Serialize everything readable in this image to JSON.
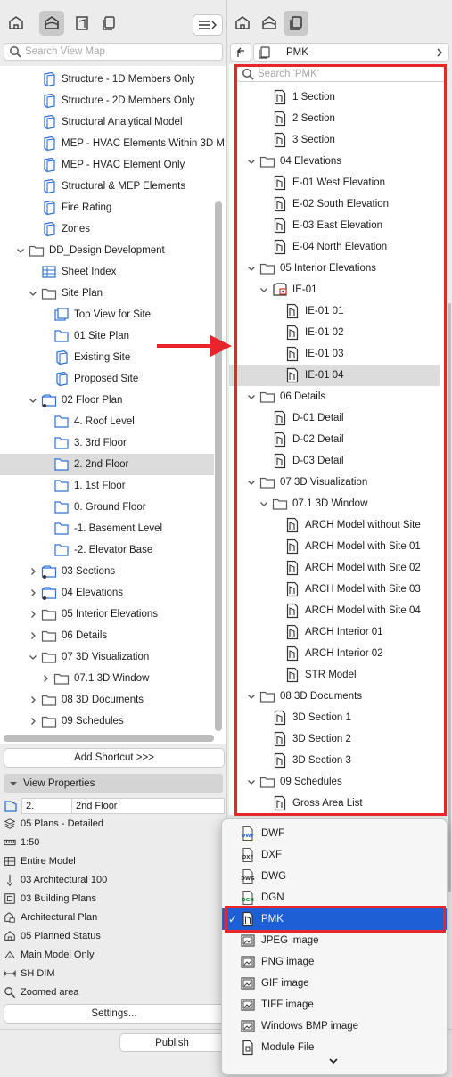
{
  "colors": {
    "accent": "#1f5fd6",
    "annotation": "#e8252b",
    "folder_icon": "#5b5b5b",
    "view_icon": "#2f6fd0"
  },
  "left_toolbar": {
    "buttons": [
      "project-map-icon",
      "view-map-icon",
      "layout-book-icon",
      "publisher-sets-icon"
    ],
    "menu_button": "menu-icon",
    "expand_button": "chevron-right-icon"
  },
  "right_toolbar": {
    "buttons": [
      "project-map-icon",
      "view-map-icon",
      "publisher-sets-icon"
    ]
  },
  "left_search": {
    "placeholder": "Search View Map"
  },
  "right_header": {
    "title": "PMK",
    "back_icon": "back-arrow-icon",
    "chevron": "chevron-right-icon"
  },
  "right_search": {
    "placeholder": "Search 'PMK'"
  },
  "left_tree": [
    {
      "label": "Structure - 1D Members Only",
      "icon": "view-3d-icon",
      "indent": 1
    },
    {
      "label": "Structure - 2D Members Only",
      "icon": "view-3d-icon",
      "indent": 1
    },
    {
      "label": "Structural Analytical Model",
      "icon": "view-3d-icon",
      "indent": 1
    },
    {
      "label": "MEP - HVAC Elements Within 3D M",
      "icon": "view-3d-icon",
      "indent": 1
    },
    {
      "label": "MEP - HVAC Element Only",
      "icon": "view-3d-icon",
      "indent": 1
    },
    {
      "label": "Structural & MEP Elements",
      "icon": "view-3d-icon",
      "indent": 1
    },
    {
      "label": "Fire Rating",
      "icon": "view-3d-icon",
      "indent": 1
    },
    {
      "label": "Zones",
      "icon": "view-3d-icon",
      "indent": 1
    },
    {
      "label": "DD_Design Development",
      "icon": "folder-icon",
      "indent": 0,
      "expand": "down"
    },
    {
      "label": "Sheet Index",
      "icon": "schedule-icon",
      "indent": 1
    },
    {
      "label": "Site Plan",
      "icon": "folder-icon",
      "indent": 1,
      "expand": "down"
    },
    {
      "label": "Top View for Site",
      "icon": "top-view-icon",
      "indent": 2
    },
    {
      "label": "01 Site Plan",
      "icon": "floor-plan-icon",
      "indent": 2
    },
    {
      "label": "Existing Site",
      "icon": "view-3d-icon",
      "indent": 2
    },
    {
      "label": "Proposed Site",
      "icon": "view-3d-icon",
      "indent": 2
    },
    {
      "label": "02 Floor Plan",
      "icon": "floor-plan-folder-icon",
      "indent": 1,
      "expand": "down"
    },
    {
      "label": "4. Roof Level",
      "icon": "floor-plan-icon",
      "indent": 2
    },
    {
      "label": "3. 3rd Floor",
      "icon": "floor-plan-icon",
      "indent": 2
    },
    {
      "label": "2. 2nd Floor",
      "icon": "floor-plan-icon",
      "indent": 2,
      "selected": true
    },
    {
      "label": "1. 1st Floor",
      "icon": "floor-plan-icon",
      "indent": 2
    },
    {
      "label": "0. Ground Floor",
      "icon": "floor-plan-icon",
      "indent": 2
    },
    {
      "label": "-1. Basement Level",
      "icon": "floor-plan-icon",
      "indent": 2
    },
    {
      "label": "-2. Elevator Base",
      "icon": "floor-plan-icon",
      "indent": 2
    },
    {
      "label": "03 Sections",
      "icon": "section-folder-icon",
      "indent": 1,
      "expand": "right"
    },
    {
      "label": "04 Elevations",
      "icon": "elevation-folder-icon",
      "indent": 1,
      "expand": "right"
    },
    {
      "label": "05 Interior Elevations",
      "icon": "folder-icon",
      "indent": 1,
      "expand": "right"
    },
    {
      "label": "06 Details",
      "icon": "folder-icon",
      "indent": 1,
      "expand": "right"
    },
    {
      "label": "07 3D Visualization",
      "icon": "folder-icon",
      "indent": 1,
      "expand": "down"
    },
    {
      "label": "07.1 3D Window",
      "icon": "folder-icon",
      "indent": 2,
      "expand": "right"
    },
    {
      "label": "08 3D Documents",
      "icon": "folder-icon",
      "indent": 1,
      "expand": "right"
    },
    {
      "label": "09 Schedules",
      "icon": "folder-icon",
      "indent": 1,
      "expand": "right"
    }
  ],
  "add_shortcut": {
    "label": "Add Shortcut >>>"
  },
  "view_properties": {
    "title": "View Properties",
    "id_value": "2.",
    "name_value": "2nd Floor",
    "rows": [
      {
        "icon": "layer-combination-icon",
        "text": "05 Plans - Detailed"
      },
      {
        "icon": "scale-icon",
        "text": "1:50"
      },
      {
        "icon": "structure-display-icon",
        "text": "Entire Model"
      },
      {
        "icon": "pen-set-icon",
        "text": "03 Architectural 100"
      },
      {
        "icon": "model-view-options-icon",
        "text": "03 Building Plans"
      },
      {
        "icon": "graphic-override-icon",
        "text": "Architectural Plan"
      },
      {
        "icon": "renovation-filter-icon",
        "text": "05 Planned Status"
      },
      {
        "icon": "partial-structure-icon",
        "text": "Main Model Only"
      },
      {
        "icon": "dimension-icon",
        "text": "SH DIM"
      },
      {
        "icon": "zoom-icon",
        "text": "Zoomed area"
      }
    ],
    "settings_label": "Settings..."
  },
  "publish_label": "Publish",
  "right_tree": [
    {
      "label": "1 Section",
      "icon": "drawing-file-icon",
      "indent": 2
    },
    {
      "label": "2 Section",
      "icon": "drawing-file-icon",
      "indent": 2
    },
    {
      "label": "3 Section",
      "icon": "drawing-file-icon",
      "indent": 2
    },
    {
      "label": "04 Elevations",
      "icon": "folder-icon",
      "indent": 1,
      "expand": "down"
    },
    {
      "label": "E-01 West Elevation",
      "icon": "drawing-file-icon",
      "indent": 2
    },
    {
      "label": "E-02 South Elevation",
      "icon": "drawing-file-icon",
      "indent": 2
    },
    {
      "label": "E-03 East Elevation",
      "icon": "drawing-file-icon",
      "indent": 2
    },
    {
      "label": "E-04 North Elevation",
      "icon": "drawing-file-icon",
      "indent": 2
    },
    {
      "label": "05 Interior Elevations",
      "icon": "folder-icon",
      "indent": 1,
      "expand": "down"
    },
    {
      "label": "IE-01",
      "icon": "interior-elevation-icon",
      "indent": 2,
      "expand": "down"
    },
    {
      "label": "IE-01 01",
      "icon": "drawing-file-icon",
      "indent": 3
    },
    {
      "label": "IE-01 02",
      "icon": "drawing-file-icon",
      "indent": 3
    },
    {
      "label": "IE-01 03",
      "icon": "drawing-file-icon",
      "indent": 3
    },
    {
      "label": "IE-01 04",
      "icon": "drawing-file-icon",
      "indent": 3,
      "selected": true
    },
    {
      "label": "06 Details",
      "icon": "folder-icon",
      "indent": 1,
      "expand": "down"
    },
    {
      "label": "D-01 Detail",
      "icon": "drawing-file-icon",
      "indent": 2
    },
    {
      "label": "D-02 Detail",
      "icon": "drawing-file-icon",
      "indent": 2
    },
    {
      "label": "D-03 Detail",
      "icon": "drawing-file-icon",
      "indent": 2
    },
    {
      "label": "07 3D Visualization",
      "icon": "folder-icon",
      "indent": 1,
      "expand": "down"
    },
    {
      "label": "07.1 3D Window",
      "icon": "folder-icon",
      "indent": 2,
      "expand": "down"
    },
    {
      "label": "ARCH Model without Site",
      "icon": "drawing-file-icon",
      "indent": 3
    },
    {
      "label": "ARCH Model with Site 01",
      "icon": "drawing-file-icon",
      "indent": 3
    },
    {
      "label": "ARCH Model with Site 02",
      "icon": "drawing-file-icon",
      "indent": 3
    },
    {
      "label": "ARCH Model with Site 03",
      "icon": "drawing-file-icon",
      "indent": 3
    },
    {
      "label": "ARCH Model with Site 04",
      "icon": "drawing-file-icon",
      "indent": 3
    },
    {
      "label": "ARCH Interior 01",
      "icon": "drawing-file-icon",
      "indent": 3
    },
    {
      "label": "ARCH Interior 02",
      "icon": "drawing-file-icon",
      "indent": 3
    },
    {
      "label": "STR Model",
      "icon": "drawing-file-icon",
      "indent": 3
    },
    {
      "label": "08 3D Documents",
      "icon": "folder-icon",
      "indent": 1,
      "expand": "down"
    },
    {
      "label": "3D Section 1",
      "icon": "drawing-file-icon",
      "indent": 2
    },
    {
      "label": "3D Section 2",
      "icon": "drawing-file-icon",
      "indent": 2
    },
    {
      "label": "3D Section 3",
      "icon": "drawing-file-icon",
      "indent": 2
    },
    {
      "label": "09 Schedules",
      "icon": "folder-icon",
      "indent": 1,
      "expand": "down"
    },
    {
      "label": "Gross Area List",
      "icon": "drawing-file-icon",
      "indent": 2
    }
  ],
  "format_menu": {
    "items": [
      {
        "label": "DWF",
        "icon": "dwf-file-icon",
        "tag": "DWF"
      },
      {
        "label": "DXF",
        "icon": "dxf-file-icon",
        "tag": "DXF"
      },
      {
        "label": "DWG",
        "icon": "dwg-file-icon",
        "tag": "DWG"
      },
      {
        "label": "DGN",
        "icon": "dgn-file-icon",
        "tag": "DGN"
      },
      {
        "label": "PMK",
        "icon": "pmk-file-icon",
        "tag": "",
        "selected": true
      },
      {
        "label": "JPEG image",
        "icon": "image-file-icon",
        "tag": ""
      },
      {
        "label": "PNG image",
        "icon": "image-file-icon",
        "tag": ""
      },
      {
        "label": "GIF image",
        "icon": "image-file-icon",
        "tag": ""
      },
      {
        "label": "TIFF image",
        "icon": "image-file-icon",
        "tag": ""
      },
      {
        "label": "Windows BMP image",
        "icon": "image-file-icon",
        "tag": ""
      },
      {
        "label": "Module File",
        "icon": "module-file-icon",
        "tag": ""
      }
    ],
    "check_glyph": "✓",
    "scroll_more": "chevron-down-icon"
  },
  "annotation": {
    "arrow": "red-arrow-icon"
  }
}
